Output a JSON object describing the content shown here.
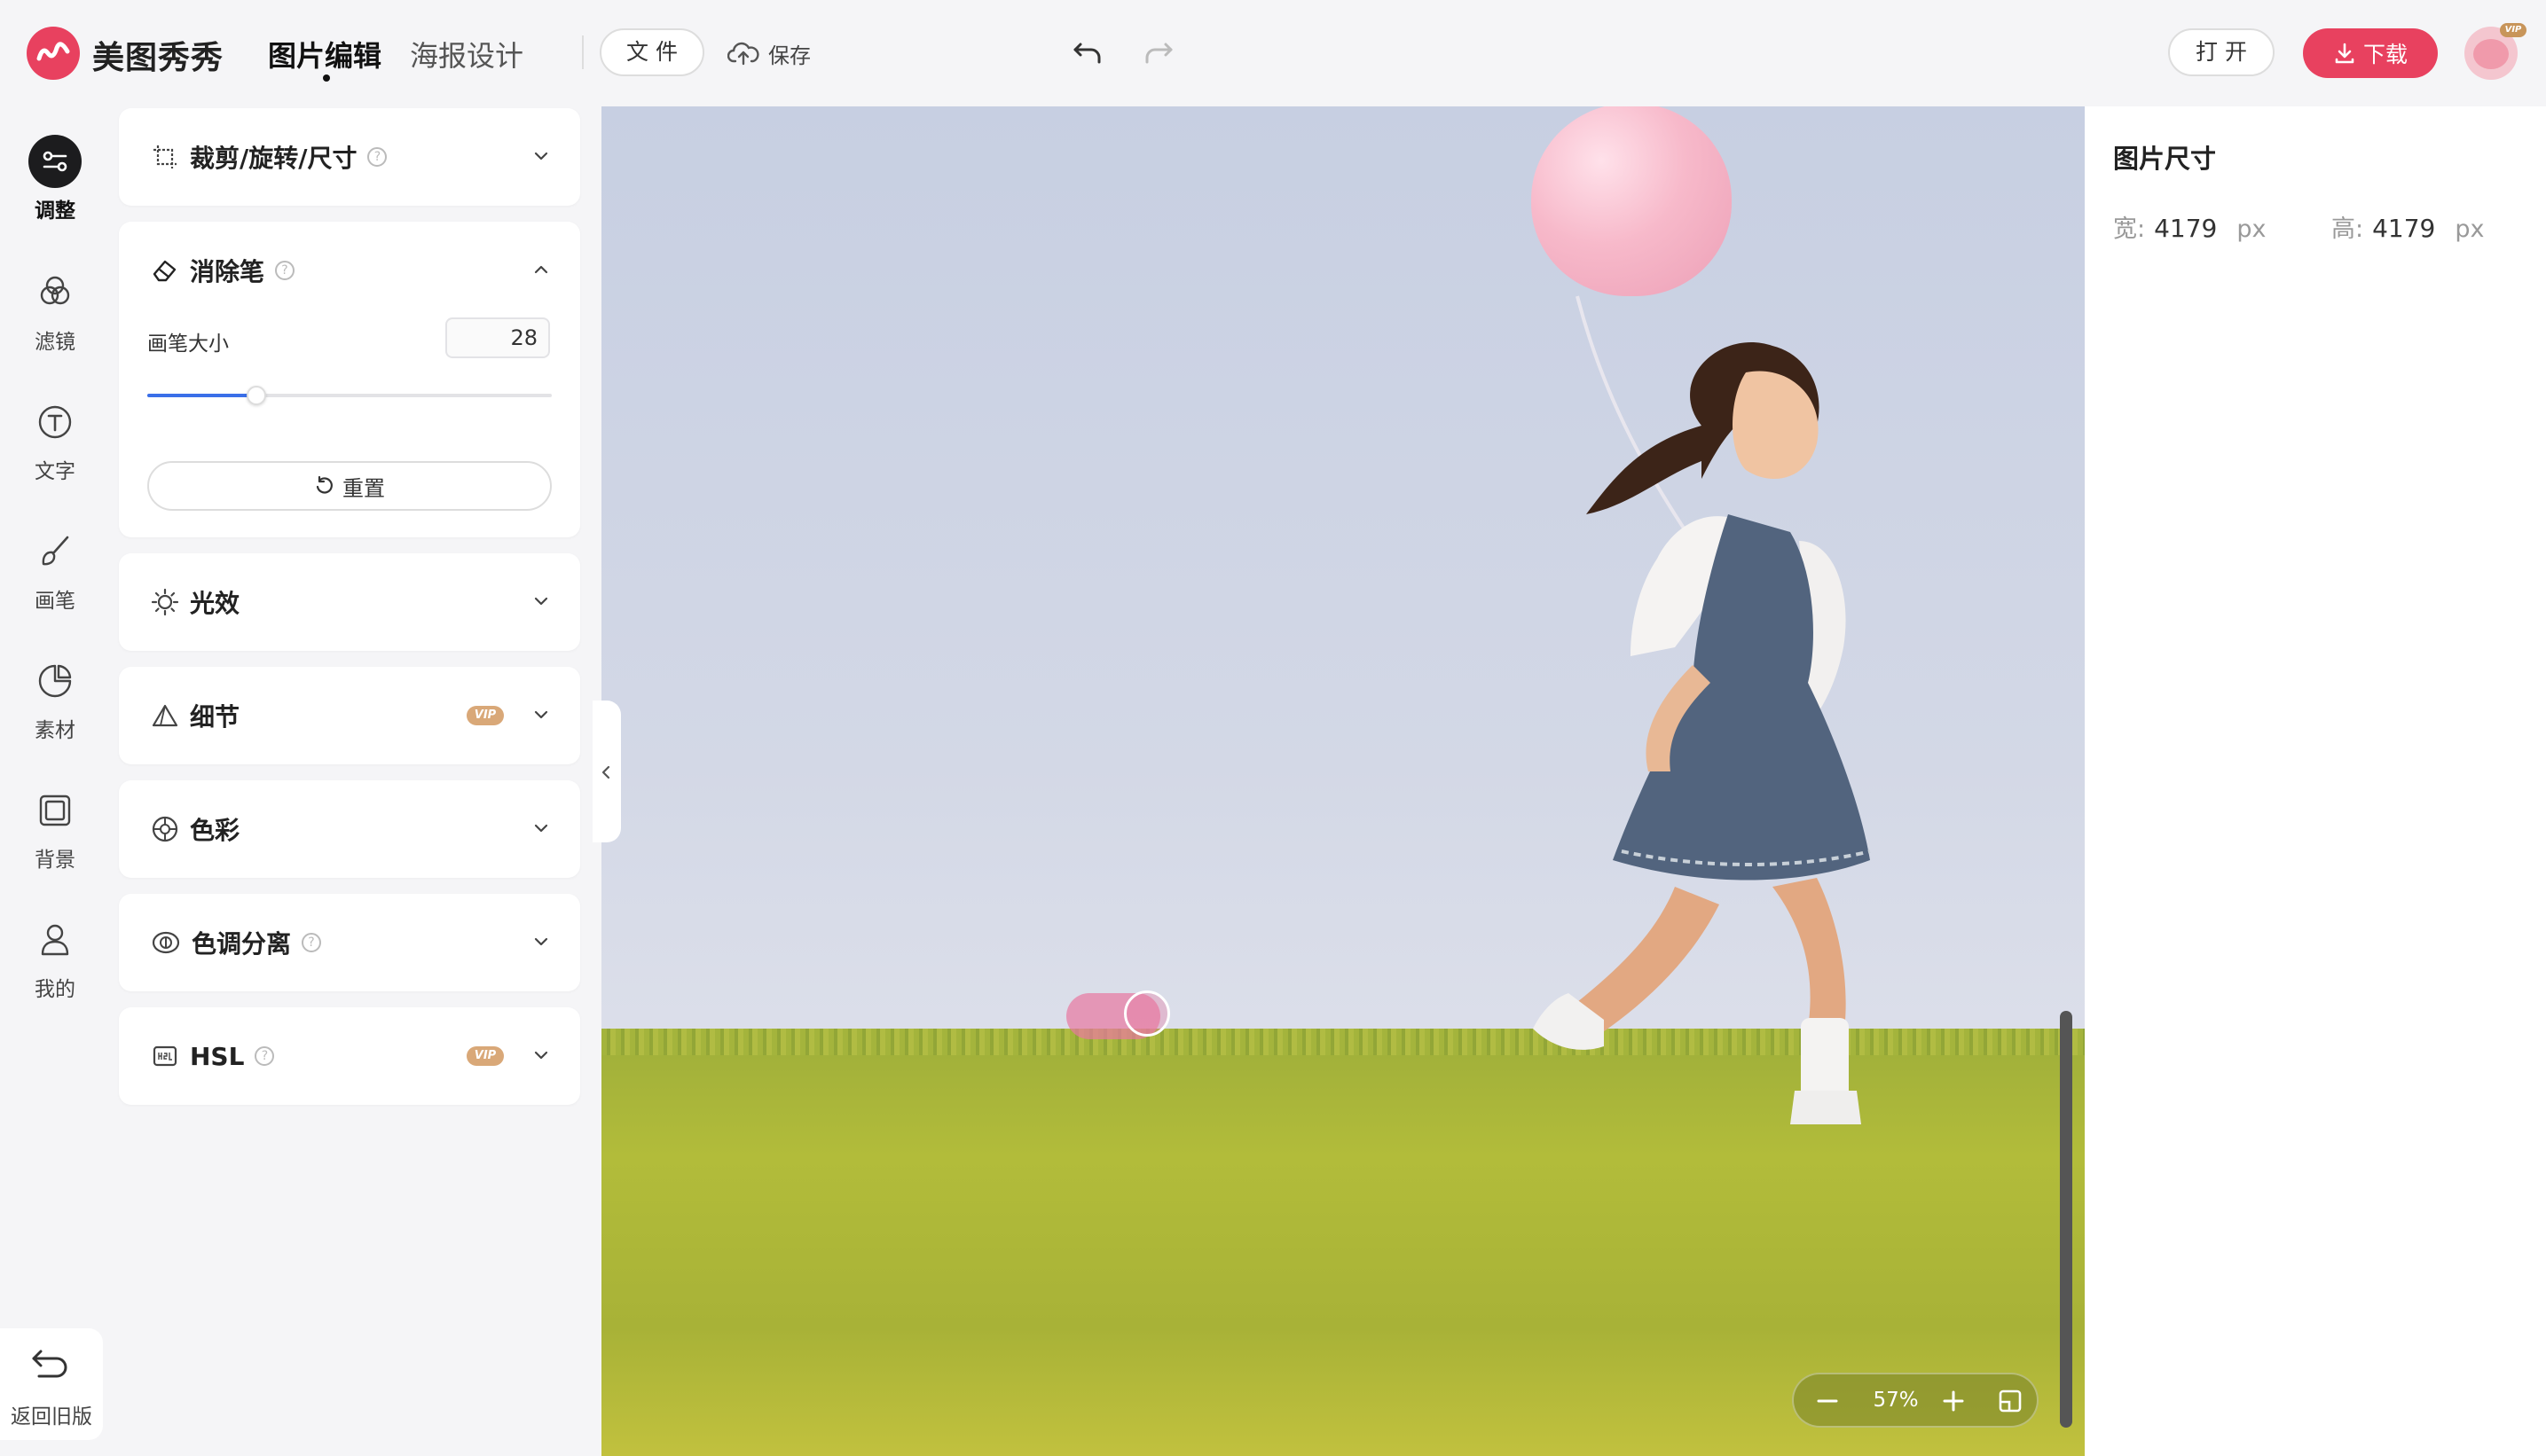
{
  "app": {
    "brand": "美图秀秀",
    "tabs": [
      "图片编辑",
      "海报设计"
    ],
    "active_tab": "图片编辑"
  },
  "toolbar": {
    "file_label": "文 件",
    "save_label": "保存",
    "open_label": "打 开",
    "download_label": "下载",
    "avatar_badge": "VIP",
    "accent_color": "#e8415f"
  },
  "nav": {
    "items": [
      {
        "label": "调整",
        "icon": "sliders-icon",
        "active": true
      },
      {
        "label": "滤镜",
        "icon": "filter-circles-icon"
      },
      {
        "label": "文字",
        "icon": "text-icon"
      },
      {
        "label": "画笔",
        "icon": "brush-icon"
      },
      {
        "label": "素材",
        "icon": "sticker-icon"
      },
      {
        "label": "背景",
        "icon": "background-frame-icon"
      },
      {
        "label": "我的",
        "icon": "user-icon"
      }
    ],
    "back_old_label": "返回旧版"
  },
  "panels": {
    "crop": {
      "title": "裁剪/旋转/尺寸"
    },
    "eraser": {
      "title": "消除笔",
      "brush_size_label": "画笔大小",
      "brush_size_value": "28",
      "brush_size_fraction": 0.27,
      "reset_label": "重置"
    },
    "light": {
      "title": "光效"
    },
    "detail": {
      "title": "细节",
      "badge": "VIP"
    },
    "color": {
      "title": "色彩"
    },
    "split_toning": {
      "title": "色调分离"
    },
    "hsl": {
      "title": "HSL",
      "badge": "VIP"
    }
  },
  "canvas": {
    "zoom": "57%"
  },
  "image_size": {
    "title": "图片尺寸",
    "width_label": "宽:",
    "width_value": "4179",
    "height_label": "高:",
    "height_value": "4179",
    "unit": "px"
  }
}
